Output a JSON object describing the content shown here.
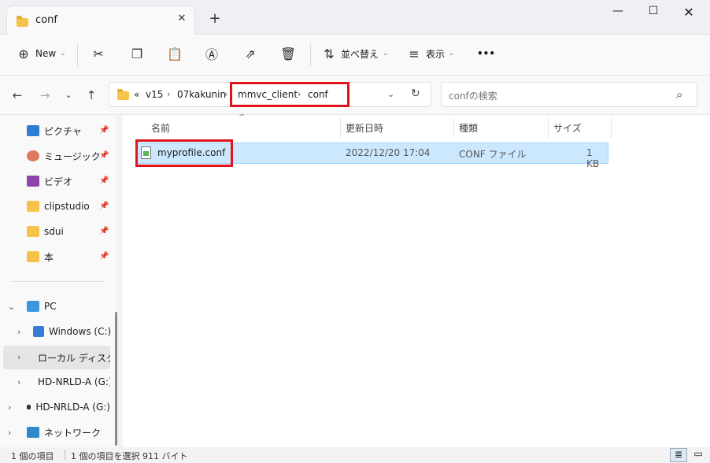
{
  "window": {
    "tab_title": "conf",
    "tab_close": "✕",
    "new_tab": "+",
    "minimize": "—",
    "maximize": "☐",
    "close": "✕"
  },
  "toolbar": {
    "new_label": "New",
    "sort_label": "並べ替え",
    "view_label": "表示",
    "more_label": "•••"
  },
  "address": {
    "overflow": "«",
    "crumbs": [
      "v15",
      "07kakunin",
      "mmvc_client",
      "conf"
    ],
    "search_placeholder": "confの検索"
  },
  "sidebar": {
    "items": [
      {
        "label": "ピクチャ",
        "icon": "pictures-icon",
        "pinned": true
      },
      {
        "label": "ミュージック",
        "icon": "music-icon",
        "pinned": true
      },
      {
        "label": "ビデオ",
        "icon": "videos-icon",
        "pinned": true
      },
      {
        "label": "clipstudio",
        "icon": "folder-icon",
        "pinned": true
      },
      {
        "label": "sdui",
        "icon": "folder-icon",
        "pinned": true
      },
      {
        "label": "本",
        "icon": "folder-icon",
        "pinned": true
      }
    ],
    "tree": [
      {
        "label": "PC",
        "icon": "pc-icon"
      },
      {
        "label": "Windows (C:)",
        "icon": "windows-drive-icon"
      },
      {
        "label": "ローカル ディスク",
        "icon": "drive-icon"
      },
      {
        "label": "HD-NRLD-A (G:)",
        "icon": "external-drive-icon"
      },
      {
        "label": "HD-NRLD-A (G:)",
        "icon": "external-drive-icon"
      },
      {
        "label": "ネットワーク",
        "icon": "network-icon"
      }
    ]
  },
  "columns": {
    "name": "名前",
    "modified": "更新日時",
    "type": "種類",
    "size": "サイズ"
  },
  "files": [
    {
      "name": "myprofile.conf",
      "modified": "2022/12/20 17:04",
      "type": "CONF ファイル",
      "size": "1 KB"
    }
  ],
  "status": {
    "count": "1 個の項目",
    "selection": "1 個の項目を選択  911 バイト"
  },
  "colors": {
    "highlight": "#e1141b",
    "selection": "#cce8ff",
    "folder": "#f6c34a"
  }
}
